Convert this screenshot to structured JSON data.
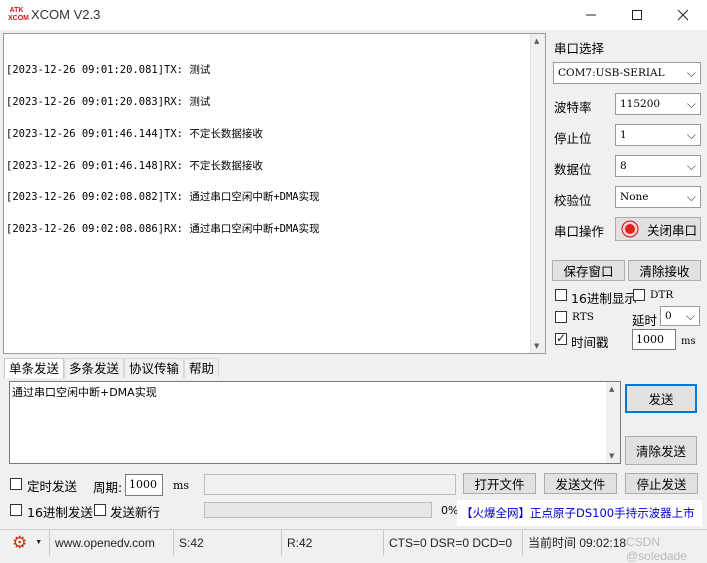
{
  "window": {
    "title": "XCOM V2.3",
    "logo_text": "ATK XCOM",
    "minimize_icon": "minimize-icon",
    "maximize_icon": "maximize-icon",
    "close_icon": "close-icon"
  },
  "log": {
    "lines": [
      "[2023-12-26 09:01:20.081]TX: 测试",
      "[2023-12-26 09:01:20.083]RX: 测试",
      "[2023-12-26 09:01:46.144]TX: 不定长数据接收",
      "[2023-12-26 09:01:46.148]RX: 不定长数据接收",
      "[2023-12-26 09:02:08.082]TX: 通过串口空闲中断+DMA实现",
      "[2023-12-26 09:02:08.086]RX: 通过串口空闲中断+DMA实现"
    ]
  },
  "panel": {
    "port_select_label": "串口选择",
    "port_value": "COM7:USB-SERIAL",
    "baud_label": "波特率",
    "baud_value": "115200",
    "stopbit_label": "停止位",
    "stopbit_value": "1",
    "databit_label": "数据位",
    "databit_value": "8",
    "parity_label": "校验位",
    "parity_value": "None",
    "port_op_label": "串口操作",
    "close_port_label": "关闭串口",
    "save_window_label": "保存窗口",
    "clear_receive_label": "清除接收",
    "hex_display_label": "16进制显示",
    "dtr_label": "DTR",
    "rts_label": "RTS",
    "delay_label": "延时",
    "delay_value": "0",
    "timestamp_label": "时间戳",
    "timestamp_value": "1000",
    "timestamp_unit": "ms",
    "hex_display_checked": false,
    "dtr_checked": false,
    "rts_checked": false,
    "timestamp_checked": true
  },
  "tabs": [
    "单条发送",
    "多条发送",
    "协议传输",
    "帮助"
  ],
  "send": {
    "text": "通过串口空闲中断+DMA实现",
    "send_label": "发送",
    "clear_send_label": "清除发送",
    "timed_send_label": "定时发送",
    "period_label": "周期:",
    "period_value": "1000",
    "period_unit": "ms",
    "open_file_label": "打开文件",
    "send_file_label": "发送文件",
    "stop_send_label": "停止发送",
    "hex_send_label": "16进制发送",
    "newline_label": "发送新行",
    "progress_text": "0%",
    "progress": 0,
    "promo": "【火爆全网】正点原子DS100手持示波器上市"
  },
  "status": {
    "gear_icon": "gear-icon",
    "url": "www.openedv.com",
    "sent": "S:42",
    "received": "R:42",
    "lines": "CTS=0 DSR=0 DCD=0",
    "time": "当前时间 09:02:18"
  },
  "watermark": "CSDN @soledade",
  "colors": {
    "accent": "#0078d7",
    "record_red": "#e02020",
    "promo_blue": "#0000cc"
  }
}
